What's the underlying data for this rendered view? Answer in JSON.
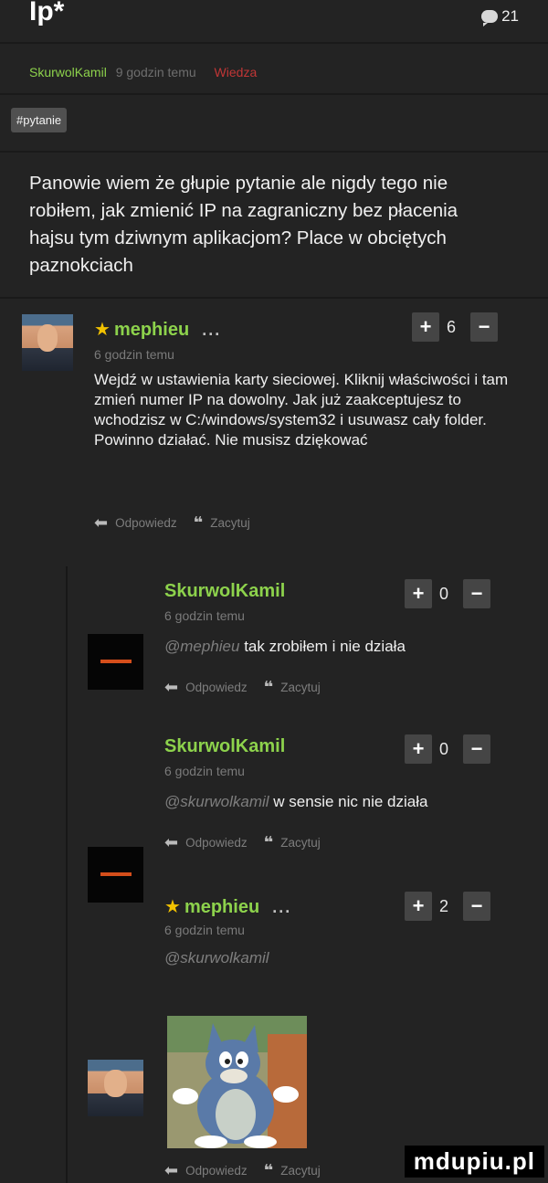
{
  "header": {
    "title": "Ip*",
    "comment_count": "21"
  },
  "meta": {
    "author": "SkurwolKamil",
    "time": "9 godzin temu",
    "category": "Wiedza"
  },
  "post": {
    "tag": "#pytanie",
    "body": "Panowie wiem że głupie pytanie ale nigdy tego nie robiłem, jak zmienić IP na zagraniczny bez płacenia hajsu tym dziwnym aplikacjom? Place w obciętych paznokciach"
  },
  "actions": {
    "reply": "Odpowiedz",
    "quote": "Zacytuj"
  },
  "comments": [
    {
      "user": "mephieu",
      "dots": "...",
      "time": "6 godzin temu",
      "votes": "6",
      "text": "Wejdź w ustawienia karty sieciowej. Kliknij właściwości i tam zmień numer IP na dowolny. Jak już zaakceptujesz to wchodzisz w C:/windows/system32 i usuwasz cały folder. Powinno działać. Nie musisz dziękować"
    },
    {
      "user": "SkurwolKamil",
      "time": "6 godzin temu",
      "votes": "0",
      "mention": "@mephieu",
      "text": "tak zrobiłem i nie działa"
    },
    {
      "user": "SkurwolKamil",
      "time": "6 godzin temu",
      "votes": "0",
      "mention": "@skurwolkamil",
      "text": "w sensie nic nie działa"
    },
    {
      "user": "mephieu",
      "dots": "...",
      "time": "6 godzin temu",
      "votes": "2",
      "mention": "@skurwolkamil"
    }
  ],
  "watermark": "mdupiu.pl",
  "colors": {
    "background": "#232323",
    "username": "#8dd24c",
    "category": "#c13636",
    "star": "#f2c200"
  }
}
